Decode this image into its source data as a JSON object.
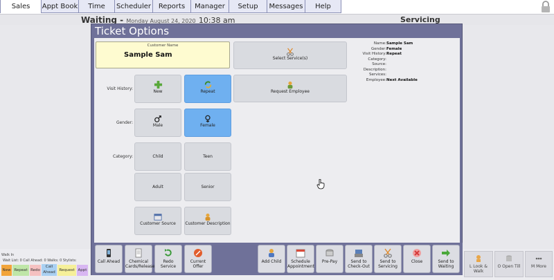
{
  "nav": {
    "tabs": [
      "Sales",
      "Appt Book",
      "Time Clock",
      "Scheduler",
      "Reports",
      "Manager",
      "Setup",
      "Messages",
      "Help"
    ],
    "active": "Sales"
  },
  "header": {
    "waiting_label": "Waiting -",
    "date": "Monday August 24, 2020",
    "time": "10:38 am",
    "servicing_label": "Servicing"
  },
  "background": {
    "walk_in": "Walk In",
    "wait_list": "Wait List: 0     Call Ahead: 0     Walks: 0   Stylists:",
    "chips": [
      "New",
      "Repeat",
      "Redo",
      "Call Ahead",
      "Request",
      "Appt"
    ],
    "right_buttons": [
      {
        "label": "L Look & Walk",
        "icon": "look-walk-icon"
      },
      {
        "label": "O Open Till",
        "icon": "open-till-icon"
      },
      {
        "label": "M More",
        "icon": "more-icon"
      }
    ]
  },
  "modal": {
    "title": "Ticket Options",
    "customer": {
      "caption": "Customer Name",
      "name": "Sample Sam"
    },
    "select_services": "Select Service(s)",
    "request_employee": "Request Employee",
    "visit_history_label": "Visit History:",
    "visit_options": [
      "New",
      "Repeat"
    ],
    "visit_selected": "Repeat",
    "gender_label": "Gender:",
    "gender_options": [
      "Male",
      "Female"
    ],
    "gender_selected": "Female",
    "category_label": "Category:",
    "category_options": [
      "Child",
      "Teen",
      "Adult",
      "Senior"
    ],
    "customer_source": "Customer Source",
    "customer_description": "Customer Description",
    "info": {
      "name_k": "Name:",
      "name_v": "Sample Sam",
      "gender_k": "Gender:",
      "gender_v": "Female",
      "visit_k": "Visit History:",
      "visit_v": "Repeat",
      "category_k": "Category:",
      "category_v": "",
      "source_k": "Source:",
      "source_v": "",
      "description_k": "Description:",
      "description_v": "",
      "services_k": "Services:",
      "services_v": "",
      "employee_k": "Employee:",
      "employee_v": "Next Available"
    },
    "footer_left": [
      {
        "label": "Call Ahead",
        "icon": "phone-icon"
      },
      {
        "label": "Chemical Cards/Release",
        "icon": "document-icon"
      },
      {
        "label": "Redo Service",
        "icon": "redo-icon"
      },
      {
        "label": "Current Offer",
        "icon": "offer-icon"
      }
    ],
    "footer_right": [
      {
        "label": "Add Child",
        "icon": "add-child-icon"
      },
      {
        "label": "Schedule Appointment",
        "icon": "calendar-icon"
      },
      {
        "label": "Pre-Pay",
        "icon": "coins-icon"
      },
      {
        "label": "Send to Check-Out",
        "icon": "register-icon"
      },
      {
        "label": "Send to Servicing",
        "icon": "scissors-icon"
      },
      {
        "label": "Close",
        "icon": "close-icon"
      },
      {
        "label": "Send to Waiting",
        "icon": "arrow-right-icon"
      }
    ]
  }
}
